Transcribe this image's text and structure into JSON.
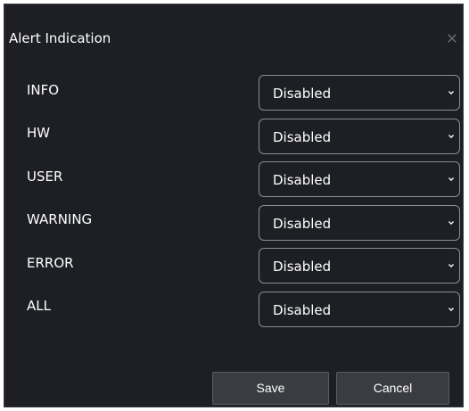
{
  "dialog": {
    "title": "Alert Indication",
    "close_icon": "close-icon"
  },
  "rows": [
    {
      "label": "INFO",
      "value": "Disabled"
    },
    {
      "label": "HW",
      "value": "Disabled"
    },
    {
      "label": "USER",
      "value": "Disabled"
    },
    {
      "label": "WARNING",
      "value": "Disabled"
    },
    {
      "label": "ERROR",
      "value": "Disabled"
    },
    {
      "label": "ALL",
      "value": "Disabled"
    }
  ],
  "buttons": {
    "save_label": "Save",
    "cancel_label": "Cancel"
  },
  "colors": {
    "background": "#1d1f24",
    "border": "#8a8d93",
    "button": "#3a3c42",
    "text": "#ffffff"
  }
}
